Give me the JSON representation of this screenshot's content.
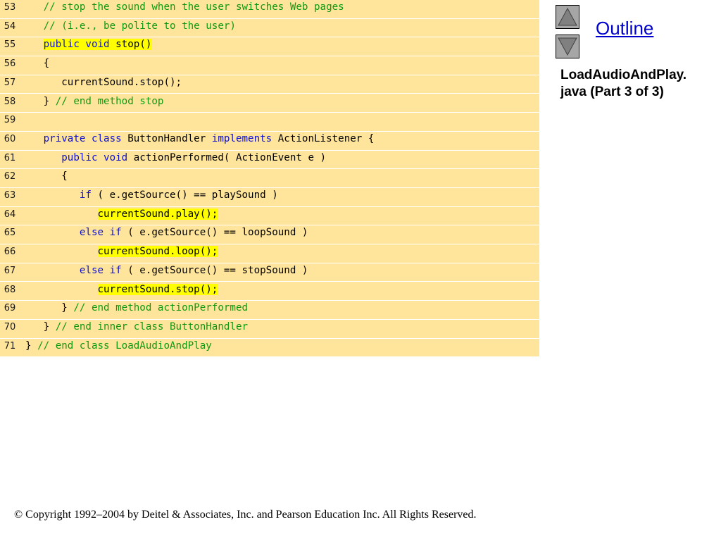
{
  "code_lines": [
    {
      "num": "53",
      "tokens": [
        {
          "t": "   "
        },
        {
          "t": "// stop the sound when the user switches Web pages",
          "k": "comment"
        }
      ]
    },
    {
      "num": "54",
      "tokens": [
        {
          "t": "   "
        },
        {
          "t": "// (i.e., be polite to the user)",
          "k": "comment"
        }
      ]
    },
    {
      "num": "55",
      "tokens": [
        {
          "t": "   "
        },
        {
          "t": "public void",
          "k": "keyword",
          "hl": true
        },
        {
          "t": " stop()",
          "hl": true
        }
      ]
    },
    {
      "num": "56",
      "tokens": [
        {
          "t": "   {"
        }
      ]
    },
    {
      "num": "57",
      "tokens": [
        {
          "t": "      currentSound.stop();"
        }
      ]
    },
    {
      "num": "58",
      "tokens": [
        {
          "t": "   } "
        },
        {
          "t": "// end method stop",
          "k": "comment"
        }
      ]
    },
    {
      "num": "59",
      "tokens": []
    },
    {
      "num": "60",
      "tokens": [
        {
          "t": "   "
        },
        {
          "t": "private class",
          "k": "keyword"
        },
        {
          "t": " ButtonHandler "
        },
        {
          "t": "implements",
          "k": "keyword"
        },
        {
          "t": " ActionListener {"
        }
      ]
    },
    {
      "num": "61",
      "tokens": [
        {
          "t": "      "
        },
        {
          "t": "public void",
          "k": "keyword"
        },
        {
          "t": " actionPerformed( ActionEvent e )"
        }
      ]
    },
    {
      "num": "62",
      "tokens": [
        {
          "t": "      {"
        }
      ]
    },
    {
      "num": "63",
      "tokens": [
        {
          "t": "         "
        },
        {
          "t": "if",
          "k": "keyword"
        },
        {
          "t": " ( e.getSource() == playSound )"
        }
      ]
    },
    {
      "num": "64",
      "tokens": [
        {
          "t": "            "
        },
        {
          "t": "currentSound.play();",
          "hl": true
        }
      ]
    },
    {
      "num": "65",
      "tokens": [
        {
          "t": "         "
        },
        {
          "t": "else if",
          "k": "keyword"
        },
        {
          "t": " ( e.getSource() == loopSound )"
        }
      ]
    },
    {
      "num": "66",
      "tokens": [
        {
          "t": "            "
        },
        {
          "t": "currentSound.loop();",
          "hl": true
        }
      ]
    },
    {
      "num": "67",
      "tokens": [
        {
          "t": "         "
        },
        {
          "t": "else if",
          "k": "keyword"
        },
        {
          "t": " ( e.getSource() == stopSound )"
        }
      ]
    },
    {
      "num": "68",
      "tokens": [
        {
          "t": "            "
        },
        {
          "t": "currentSound.stop();",
          "hl": true
        }
      ]
    },
    {
      "num": "69",
      "tokens": [
        {
          "t": "      } "
        },
        {
          "t": "// end method actionPerformed",
          "k": "comment"
        }
      ]
    },
    {
      "num": "70",
      "tokens": [
        {
          "t": "   } "
        },
        {
          "t": "// end inner class ButtonHandler",
          "k": "comment"
        }
      ]
    },
    {
      "num": "71",
      "tokens": [
        {
          "t": "} "
        },
        {
          "t": "// end class LoadAudioAndPlay",
          "k": "comment"
        }
      ]
    }
  ],
  "sidebar": {
    "outline_label": "Outline",
    "file_title_line1": "LoadAudioAndPlay.",
    "file_title_line2": "java (Part 3 of 3)",
    "up_icon": "triangle-up-icon",
    "down_icon": "triangle-down-icon"
  },
  "footer": {
    "copyright": "© Copyright 1992–2004 by Deitel & Associates, Inc. and Pearson Education Inc. All Rights Reserved."
  },
  "colors": {
    "code_background": "#ffe59b",
    "comment": "#109910",
    "keyword": "#1010cc",
    "highlight": "#ffff00",
    "link": "#0000cc"
  }
}
